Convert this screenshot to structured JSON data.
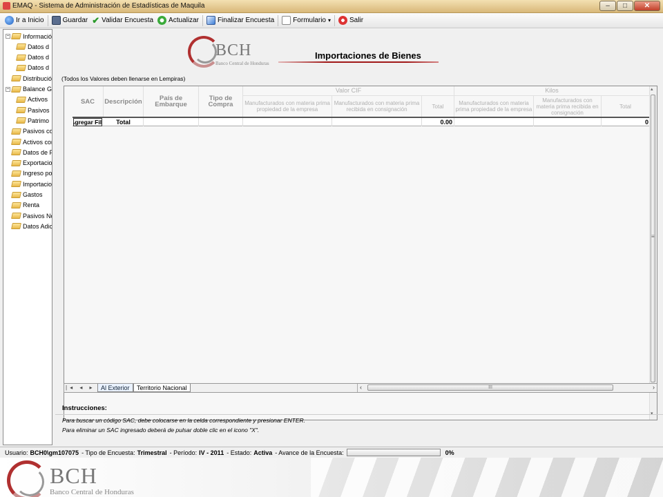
{
  "window": {
    "title": "EMAQ - Sistema de Administración de Estadísticas de Maquila",
    "controls": {
      "minimize": "–",
      "maximize": "□",
      "close": "✕"
    }
  },
  "toolbar": {
    "home": "Ir a Inicio",
    "save": "Guardar",
    "validate": "Validar Encuesta",
    "refresh": "Actualizar",
    "finish": "Finalizar Encuesta",
    "form": "Formulario",
    "form_arrow": "▾",
    "exit": "Salir"
  },
  "tree": {
    "expanders": {
      "minus": "−",
      "plus": "+"
    },
    "items": [
      {
        "label": "Información",
        "level": 0,
        "expander": "minus"
      },
      {
        "label": "Datos d",
        "level": 1
      },
      {
        "label": "Datos d",
        "level": 1
      },
      {
        "label": "Datos d",
        "level": 1
      },
      {
        "label": "Distribución",
        "level": 0
      },
      {
        "label": "Balance Ge",
        "level": 0,
        "expander": "minus"
      },
      {
        "label": "Activos",
        "level": 1
      },
      {
        "label": "Pasivos",
        "level": 1
      },
      {
        "label": "Patrimo",
        "level": 1
      },
      {
        "label": "Pasivos cor",
        "level": 0
      },
      {
        "label": "Activos con",
        "level": 0
      },
      {
        "label": "Datos de Pr",
        "level": 0
      },
      {
        "label": "Exportacion",
        "level": 0
      },
      {
        "label": "Ingreso por",
        "level": 0
      },
      {
        "label": "Importacion",
        "level": 0
      },
      {
        "label": "Gastos",
        "level": 0
      },
      {
        "label": "Renta",
        "level": 0
      },
      {
        "label": "Pasivos No",
        "level": 0
      },
      {
        "label": "Datos Adici",
        "level": 0
      }
    ]
  },
  "header": {
    "logo_text": "BCH",
    "logo_sub": "Banco Central de Honduras",
    "page_title": "Importaciones de Bienes",
    "note": "(Todos los Valores deben llenarse en Lempiras)"
  },
  "grid": {
    "group_cif": "Valor CIF",
    "group_kilos": "Kilos",
    "col_sac": "SAC",
    "col_desc": "Descripción",
    "col_pais": "País de Embarque",
    "col_tipo": "Tipo de Compra",
    "col_cif_propia": "Manufacturados con materia prima propiedad de la empresa",
    "col_cif_consig": "Manufacturados con materia prima recibida en consignación",
    "col_cif_total": "Total",
    "col_kg_propia": "Manufacturados con materia prima propiedad de la empresa",
    "col_kg_consig": "Manufacturados con materia prima recibida en consignación",
    "col_kg_total": "Total",
    "add_row": "Agregar Fila",
    "total_label": "Total",
    "total_cif": "0.00",
    "total_kilos": "0",
    "vscroll_grip": "≡",
    "hscroll_grip": "III",
    "scroll_up": "▴",
    "scroll_down": "▾",
    "scroll_left": "‹",
    "scroll_right": "›"
  },
  "tabs": {
    "nav": "|◂ ◂ ▸ ▸|",
    "items": [
      "Al Exterior",
      "Territorio Nacional"
    ]
  },
  "instructions": {
    "title": "Instrucciones:",
    "line1": "Para buscar un código SAC, debe colocarse en la celda correspondiente y presionar ENTER.",
    "line2": "Para eliminar un SAC ingresado deberá de pulsar doble clic en el icono \"X\"."
  },
  "status": {
    "user_label": "Usuario:",
    "user_value": "BCH0\\gm107075",
    "type_label": "- Tipo de Encuesta:",
    "type_value": "Trimestral",
    "period_label": "- Período:",
    "period_value": "IV - 2011",
    "state_label": "- Estado:",
    "state_value": "Activa",
    "progress_label": "- Avance de la Encuesta:",
    "progress_value": "0%",
    "progress_fraction": 0
  },
  "footer": {
    "logo_text": "BCH",
    "logo_sub": "Banco Central de Honduras"
  },
  "colors": {
    "accent": "#a01818",
    "progress": "#3cb043"
  }
}
